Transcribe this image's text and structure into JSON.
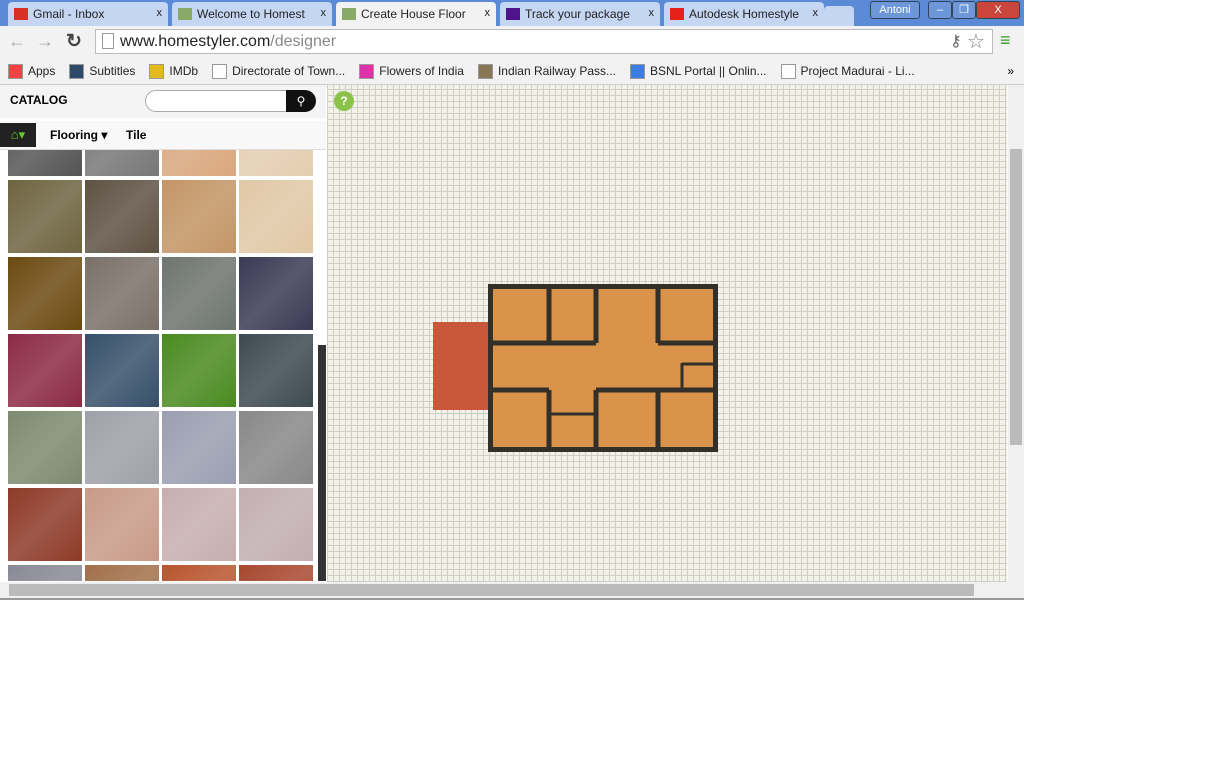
{
  "browser": {
    "tabs": [
      {
        "label": "Gmail - Inbox",
        "icon": "gmail-icon",
        "color": "#d93025"
      },
      {
        "label": "Welcome to Homest",
        "icon": "homestyler-icon",
        "color": "#8a6"
      },
      {
        "label": "Create House Floor",
        "icon": "homestyler-icon",
        "color": "#8a6",
        "active": true
      },
      {
        "label": "Track your package",
        "icon": "fedex-icon",
        "color": "#4d148c"
      },
      {
        "label": "Autodesk Homestyle",
        "icon": "youtube-icon",
        "color": "#e62117"
      }
    ],
    "close_glyph": "x",
    "user": "Antoni",
    "url_host": "www.homestyler.com",
    "url_path": "/designer",
    "bookmarks": [
      {
        "label": "Apps",
        "color": "#e44"
      },
      {
        "label": "Subtitles",
        "color": "#2d4a6b"
      },
      {
        "label": "IMDb",
        "color": "#e6b91e"
      },
      {
        "label": "Directorate of Town...",
        "color": "#fff"
      },
      {
        "label": "Flowers of India",
        "color": "#d3a"
      },
      {
        "label": "Indian Railway Pass...",
        "color": "#875"
      },
      {
        "label": "BSNL Portal || Onlin...",
        "color": "#3b7de0"
      },
      {
        "label": "Project Madurai - Li...",
        "color": "#fff"
      }
    ],
    "more": "»"
  },
  "catalog": {
    "title": "CATALOG",
    "search_placeholder": "",
    "crumbs": [
      "Flooring ▾",
      "Tile"
    ],
    "tiles": [
      "#555",
      "#777",
      "#d9a77e",
      "#e4cdb0",
      "#6e6440",
      "#5e5243",
      "#c39566",
      "#e0c8a5",
      "#6b4a10",
      "#7a7068",
      "#6e7470",
      "#3a3a55",
      "#8c2a44",
      "#36506a",
      "#4a8a20",
      "#3c4a50",
      "#7d8a70",
      "#9ea0a8",
      "#9a9eb0",
      "#888",
      "#8e3a28",
      "#c89a88",
      "#c7aeae",
      "#c2aeb0",
      "#8a8a96",
      "#a2704a",
      "#b8552e",
      "#a84830"
    ]
  },
  "help": "?",
  "floorplan": {
    "floor_color": "#d9934a",
    "wall_color": "#333029",
    "porch_color": "#c9583a"
  }
}
